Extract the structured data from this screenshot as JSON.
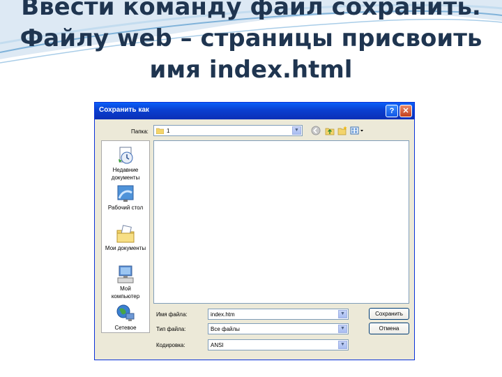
{
  "slide": {
    "title_line1": "Ввести команду файл сохранить.",
    "title_line2": "Файлу web – страницы присвоить",
    "title_line3": "имя index.html"
  },
  "dialog": {
    "title": "Сохранить как",
    "help_button": "?",
    "close_button": "✕",
    "folder_label": "Папка:",
    "folder_value": "1",
    "places": [
      {
        "label_line1": "Недавние",
        "label_line2": "документы",
        "icon": "recent-documents-icon"
      },
      {
        "label_line1": "Рабочий стол",
        "label_line2": "",
        "icon": "desktop-icon"
      },
      {
        "label_line1": "Мои документы",
        "label_line2": "",
        "icon": "my-documents-icon"
      },
      {
        "label_line1": "Мой",
        "label_line2": "компьютер",
        "icon": "my-computer-icon"
      },
      {
        "label_line1": "Сетевое",
        "label_line2": "",
        "icon": "network-icon"
      }
    ],
    "filename_label": "Имя файла:",
    "filename_value": "index.htm",
    "filetype_label": "Тип файла:",
    "filetype_value": "Все файлы",
    "encoding_label": "Кодировка:",
    "encoding_value": "ANSI",
    "save_button": "Сохранить",
    "cancel_button": "Отмена"
  }
}
